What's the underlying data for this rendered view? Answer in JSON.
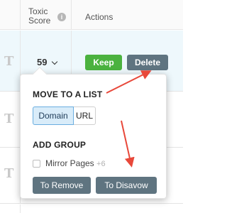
{
  "header": {
    "toxic_score_line1": "Toxic",
    "toxic_score_line2": "Score",
    "info_glyph": "i",
    "actions": "Actions"
  },
  "rows": [
    {
      "glyph": "T",
      "score": "59"
    },
    {
      "glyph": "T"
    },
    {
      "glyph": "T"
    },
    {
      "glyph": "T"
    }
  ],
  "actions": {
    "keep": "Keep",
    "delete": "Delete"
  },
  "popover": {
    "move_title": "MOVE TO A LIST",
    "segments": [
      "Domain",
      "URL"
    ],
    "selected_segment": "Domain",
    "add_group_title": "ADD GROUP",
    "mirror_pages_label": "Mirror Pages",
    "mirror_pages_count": "+6",
    "mirror_pages_checked": false,
    "to_remove": "To Remove",
    "to_disavow": "To Disavow"
  },
  "colors": {
    "keep_green": "#4bb23f",
    "slate_button": "#5f7480",
    "annotation_arrow": "#e8483a",
    "selected_segment_bg": "#d9ecf9",
    "highlight_row_bg": "#eef8fc"
  },
  "icons": [
    "info-icon",
    "chevron-down-icon",
    "checkbox-icon",
    "annotation-arrow"
  ]
}
